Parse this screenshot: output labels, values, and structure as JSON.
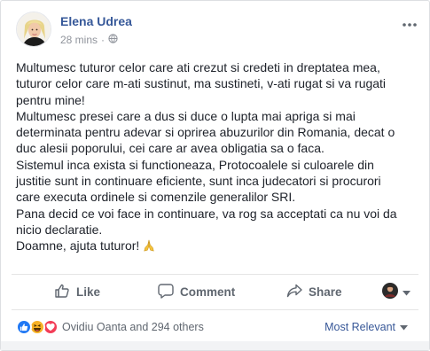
{
  "post": {
    "author": "Elena Udrea",
    "time": "28 mins",
    "lines": [
      "Multumesc tuturor celor care ati crezut si credeti in dreptatea mea,",
      "tuturor celor care m-ati sustinut, ma sustineti, v-ati rugat si va rugati",
      "pentru mine!",
      "Multumesc presei care a dus si duce o lupta mai apriga si mai",
      "determinata pentru adevar si oprirea abuzurilor din Romania, decat o",
      "duc alesii poporului, cei care ar avea obligatia sa o faca.",
      "Sistemul inca exista si functioneaza, Protocoalele si culoarele din",
      "justitie sunt in continuare eficiente, sunt inca judecatori si procurori",
      "care executa ordinele si comenzile generalilor SRI.",
      "Pana decid ce voi face in continuare, va rog sa acceptati ca nu voi da",
      "nicio declaratie.",
      "Doamne, ajuta tuturor!"
    ]
  },
  "actions": {
    "like": "Like",
    "comment": "Comment",
    "share": "Share"
  },
  "footer": {
    "reactions_text": "Ovidiu Oanta and 294 others",
    "sort_label": "Most Relevant"
  },
  "colors": {
    "author_link": "#365899",
    "like_blue": "#2078f4",
    "love_red": "#f33e58",
    "haha_yellow": "#f7b125"
  },
  "icons": [
    "avatar",
    "globe-icon",
    "more-options-icon",
    "praying-hands-icon",
    "like-icon",
    "comment-icon",
    "share-icon",
    "audience-avatar",
    "dropdown-arrow-icon",
    "like-reaction-icon",
    "haha-reaction-icon",
    "love-reaction-icon"
  ]
}
